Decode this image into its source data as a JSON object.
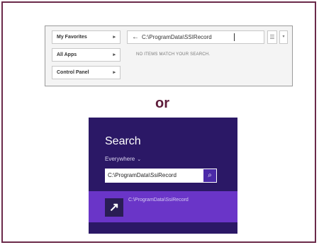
{
  "or_label": "or",
  "explorer": {
    "menu": [
      {
        "label": "My Favorites",
        "chevron": "▸"
      },
      {
        "label": "All Apps",
        "chevron": "▸"
      },
      {
        "label": "Control Panel",
        "chevron": "▸"
      }
    ],
    "back_icon": "←",
    "search_value": "C:\\ProgramData\\SSIRecord",
    "list_icon": "☰",
    "dropdown_icon": "▾",
    "empty_message": "NO ITEMS MATCH YOUR SEARCH."
  },
  "win8": {
    "title": "Search",
    "scope": "Everywhere",
    "scope_chevron": "⌄",
    "search_value": "C:\\ProgramData\\SsiRecord",
    "search_button_icon": "⌕",
    "result_icon": "↗",
    "result_text": "C:\\ProgramData\\SsiRecord",
    "colors": {
      "background": "#2b1866",
      "result_highlight": "#6a35c8",
      "frame": "#6b2a4a"
    }
  }
}
